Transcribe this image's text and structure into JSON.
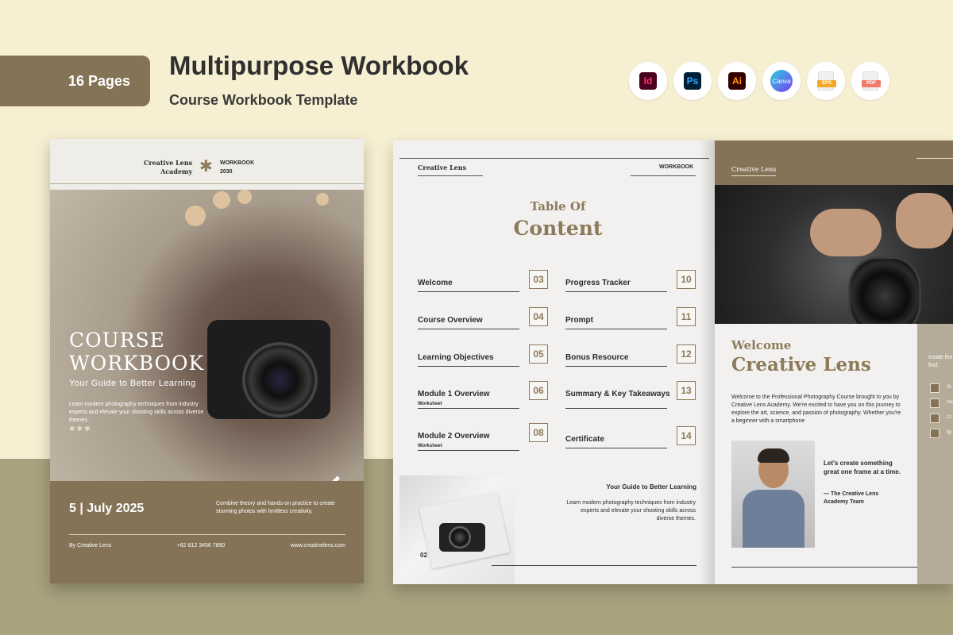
{
  "header": {
    "pages_badge": "16 Pages",
    "title": "Multipurpose Workbook",
    "subtitle": "Course Workbook Template"
  },
  "apps": [
    {
      "name": "indesign-icon",
      "label": "Id",
      "bg": "#49021f",
      "fg": "#ff3366"
    },
    {
      "name": "photoshop-icon",
      "label": "Ps",
      "bg": "#001e36",
      "fg": "#31a8ff"
    },
    {
      "name": "illustrator-icon",
      "label": "Ai",
      "bg": "#330000",
      "fg": "#ff9a00"
    },
    {
      "name": "canva-icon",
      "label": "Canva"
    },
    {
      "name": "eps-file-icon",
      "label": "EPS",
      "color": "#f5a623"
    },
    {
      "name": "pdf-file-icon",
      "label": "PDF",
      "color": "#f17a6b"
    }
  ],
  "cover": {
    "brand_line1": "Creative Lens",
    "brand_line2": "Academy",
    "workbook_line1": "WORKBOOK",
    "workbook_line2": "2030",
    "title_line1": "COURSE",
    "title_line2": "WORKBOOK",
    "tagline": "Your Guide to Better Learning",
    "description": "Learn modern photography techniques from industry experts and elevate your shooting skills across diverse themes.",
    "date": "5 | July 2025",
    "combine_text": "Combine theory and hands-on practice to create stunning photos with limitless creativity.",
    "footer_by": "By Creative Lens",
    "footer_phone": "+62 812 3456 7890",
    "footer_web": "www.creativelens.com"
  },
  "toc_page": {
    "brand": "Creative Lens",
    "workbook": "WORKBOOK",
    "title_line1": "Table Of",
    "title_line2": "Content",
    "items_left": [
      {
        "label": "Welcome",
        "sub": "",
        "num": "03"
      },
      {
        "label": "Course Overview",
        "sub": "",
        "num": "04"
      },
      {
        "label": "Learning Objectives",
        "sub": "",
        "num": "05"
      },
      {
        "label": "Module 1 Overview",
        "sub": "Worksheet",
        "num": "06"
      },
      {
        "label": "Module 2 Overview",
        "sub": "Worksheet",
        "num": "08"
      }
    ],
    "items_right": [
      {
        "label": "Progress Tracker",
        "sub": "",
        "num": "10"
      },
      {
        "label": "Prompt",
        "sub": "",
        "num": "11"
      },
      {
        "label": "Bonus Resource",
        "sub": "",
        "num": "12"
      },
      {
        "label": "Summary & Key Takeaways",
        "sub": "",
        "num": "13"
      },
      {
        "label": "Certificate",
        "sub": "",
        "num": "14"
      }
    ],
    "guide_title": "Your Guide to Better Learning",
    "guide_desc": "Learn modern photography techniques from industry experts and elevate your shooting skills across diverse themes.",
    "page_number": "02"
  },
  "welcome_page": {
    "brand": "Creative Lens",
    "welcome": "Welcome",
    "name": "Creative Lens",
    "intro": "Welcome to the Professional Photography Course brought to you by Creative Lens Academy. We're excited to have you on this journey to explore the art, science, and passion of photography. Whether you're a beginner with a smartphone",
    "quote": "Let's create something great one frame at a time.",
    "signature": "— The Creative Lens Academy Team",
    "side_text": "Inside the find:",
    "side_items": [
      "St",
      "Ha",
      "Cr",
      "tip"
    ]
  }
}
